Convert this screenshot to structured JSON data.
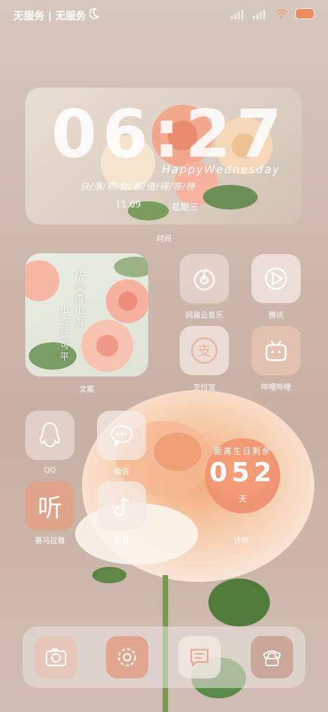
{
  "status_bar": {
    "carrier": "无服务 | 无服务"
  },
  "clock_widget": {
    "time": "06:27",
    "greeting": "HappyWednesday",
    "poem": "日/落/和/你/都/值/得/等/待",
    "date": "11.09",
    "weekday": "星期三",
    "label": "时间"
  },
  "text_widget": {
    "line1": "所爱隔山海",
    "line2": "山海皆可平",
    "label": "文案"
  },
  "apps": {
    "netease_music": "网易云音乐",
    "tencent": "腾讯",
    "alipay": "支付宝",
    "bilibili": "哔哩哔哩",
    "qq": "QQ",
    "wechat": "微信",
    "ximalaya": "喜马拉雅",
    "douyin": "抖音",
    "timer": "计时"
  },
  "countdown": {
    "title": "距离生日剩余",
    "value": "052",
    "unit": "天"
  },
  "dock_icons": [
    "camera-icon",
    "settings-icon",
    "messages-icon",
    "phone-icon"
  ],
  "colors": {
    "accent": "#f08a5d",
    "tile": "#f0e1d7"
  }
}
